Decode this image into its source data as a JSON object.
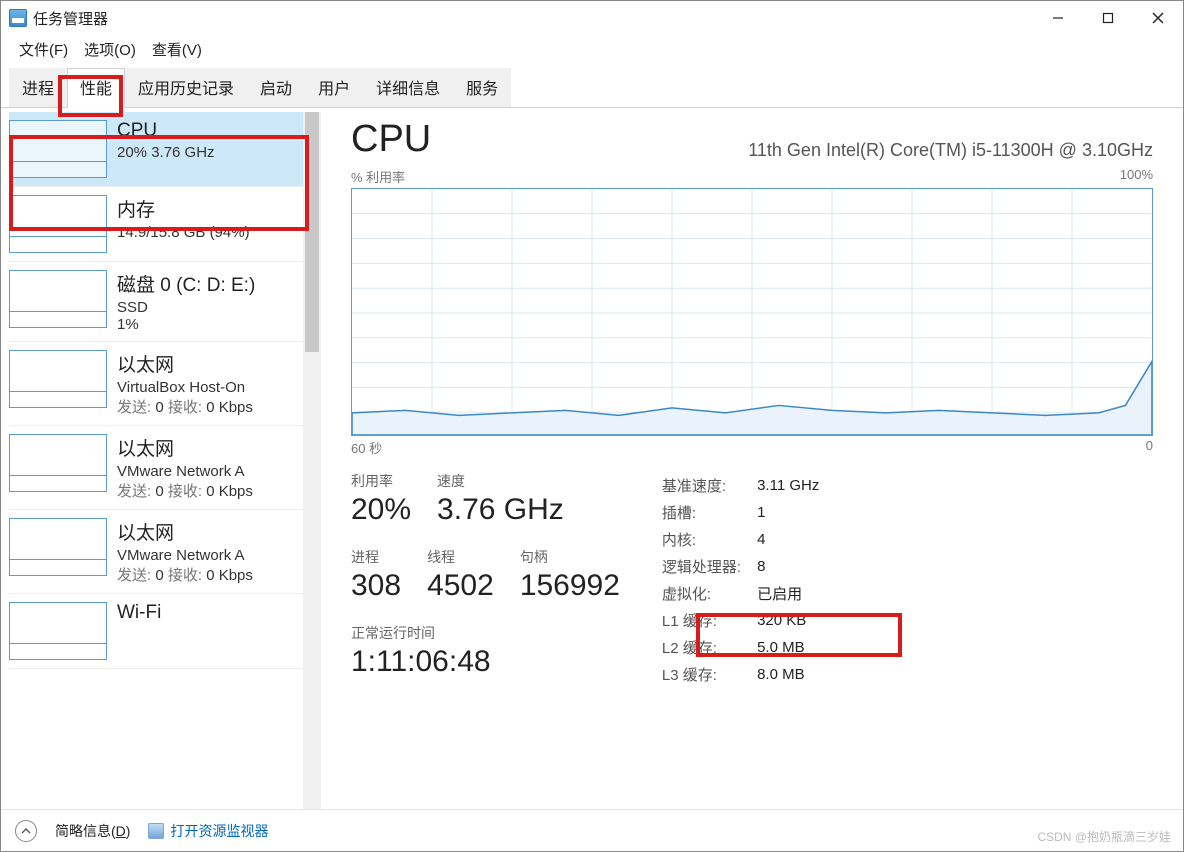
{
  "window": {
    "title": "任务管理器"
  },
  "menus": {
    "file": "文件(F)",
    "options": "选项(O)",
    "view": "查看(V)"
  },
  "tabs": {
    "processes": "进程",
    "performance": "性能",
    "appHistory": "应用历史记录",
    "startup": "启动",
    "users": "用户",
    "details": "详细信息",
    "services": "服务"
  },
  "sidebar": [
    {
      "title": "CPU",
      "sub": "20% 3.76 GHz"
    },
    {
      "title": "内存",
      "sub": "14.9/15.8 GB (94%)"
    },
    {
      "title": "磁盘 0 (C: D: E:)",
      "sub": "SSD",
      "sub2": "1%"
    },
    {
      "title": "以太网",
      "sub": "VirtualBox Host-On",
      "sub2": "发送: 0 接收: 0 Kbps"
    },
    {
      "title": "以太网",
      "sub": "VMware Network A",
      "sub2": "发送: 0 接收: 0 Kbps"
    },
    {
      "title": "以太网",
      "sub": "VMware Network A",
      "sub2": "发送: 0 接收: 0 Kbps"
    },
    {
      "title": "Wi-Fi",
      "sub": ""
    }
  ],
  "main": {
    "title": "CPU",
    "model": "11th Gen Intel(R) Core(TM) i5-11300H @ 3.10GHz",
    "chart_top_left": "% 利用率",
    "chart_top_right": "100%",
    "chart_bottom_left": "60 秒",
    "chart_bottom_right": "0",
    "stats_primary": [
      {
        "lbl": "利用率",
        "val": "20%"
      },
      {
        "lbl": "速度",
        "val": "3.76 GHz"
      }
    ],
    "stats_secondary": [
      {
        "lbl": "进程",
        "val": "308"
      },
      {
        "lbl": "线程",
        "val": "4502"
      },
      {
        "lbl": "句柄",
        "val": "156992"
      }
    ],
    "uptime_label": "正常运行时间",
    "uptime_value": "1:11:06:48",
    "details": [
      {
        "k": "基准速度:",
        "v": "3.11 GHz"
      },
      {
        "k": "插槽:",
        "v": "1"
      },
      {
        "k": "内核:",
        "v": "4"
      },
      {
        "k": "逻辑处理器:",
        "v": "8"
      },
      {
        "k": "虚拟化:",
        "v": "已启用"
      },
      {
        "k": "L1 缓存:",
        "v": "320 KB"
      },
      {
        "k": "L2 缓存:",
        "v": "5.0 MB"
      },
      {
        "k": "L3 缓存:",
        "v": "8.0 MB"
      }
    ]
  },
  "footer": {
    "less": "简略信息(",
    "less_key": "D",
    "less_suffix": ")",
    "resmon": "打开资源监视器"
  },
  "watermark": "CSDN @抱奶瓶滴三岁娃",
  "chart_data": {
    "type": "line",
    "title": "CPU % 利用率",
    "xlabel": "秒",
    "ylabel": "%",
    "xlim": [
      0,
      60
    ],
    "ylim": [
      0,
      100
    ],
    "x": [
      60,
      56,
      52,
      48,
      44,
      40,
      36,
      32,
      28,
      24,
      20,
      16,
      12,
      8,
      4,
      2,
      0
    ],
    "values": [
      9,
      10,
      8,
      9,
      10,
      8,
      11,
      9,
      12,
      10,
      9,
      10,
      9,
      8,
      9,
      12,
      30
    ]
  }
}
